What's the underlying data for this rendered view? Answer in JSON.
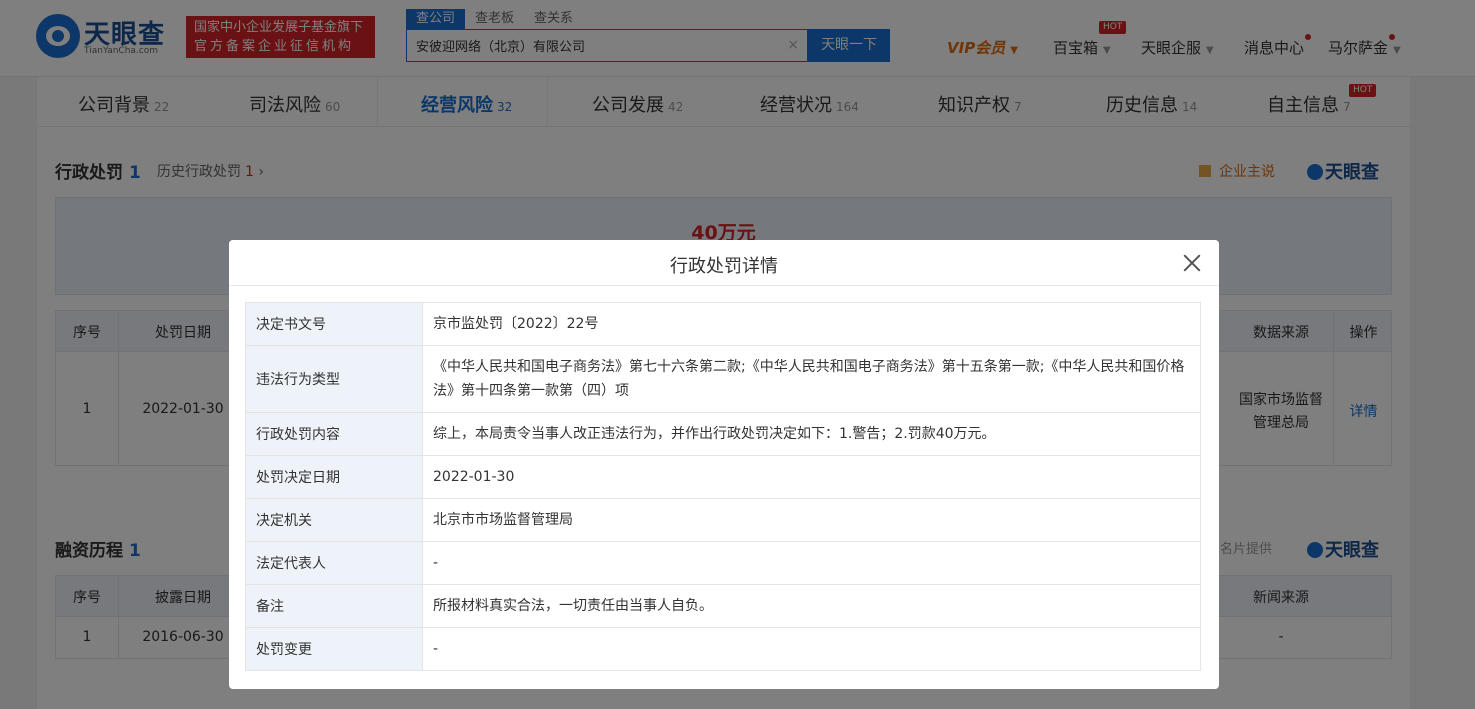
{
  "header": {
    "logo_text": "天眼查",
    "logo_sub": "TianYanCha.com",
    "red_badge_line1": "国家中小企业发展子基金旗下",
    "red_badge_line2": "官方备案企业征信机构",
    "search_tabs": [
      "查公司",
      "查老板",
      "查关系"
    ],
    "search_value": "安彼迎网络（北京）有限公司",
    "search_clear": "×",
    "search_button": "天眼一下",
    "nav": {
      "vip": "VIP会员",
      "baibaoxiang": "百宝箱",
      "hot": "HOT",
      "qifu": "天眼企服",
      "messages": "消息中心",
      "user": "马尔萨金"
    }
  },
  "tabs": [
    {
      "label": "公司背景",
      "count": "22"
    },
    {
      "label": "司法风险",
      "count": "60"
    },
    {
      "label": "经营风险",
      "count": "32"
    },
    {
      "label": "公司发展",
      "count": "42"
    },
    {
      "label": "经营状况",
      "count": "164"
    },
    {
      "label": "知识产权",
      "count": "7"
    },
    {
      "label": "历史信息",
      "count": "14"
    },
    {
      "label": "自主信息",
      "count": "7"
    }
  ],
  "tab_hot": "HOT",
  "penalty_section": {
    "title": "行政处罚",
    "count": "1",
    "history_label": "历史行政处罚",
    "history_count": "1",
    "history_arrow": "›",
    "ent_say": "企业主说",
    "brand": "天眼查",
    "amount": "40万元",
    "table_headers": [
      "序号",
      "处罚日期",
      "数据来源",
      "操作"
    ],
    "row": {
      "index": "1",
      "date": "2022-01-30",
      "source": "国家市场监督管理总局",
      "action": "详情"
    }
  },
  "finance_section": {
    "title": "融资历程",
    "count": "1",
    "provided_by": "企名片提供",
    "brand": "天眼查",
    "table_headers": [
      "序号",
      "披露日期",
      "新闻来源"
    ],
    "row": {
      "index": "1",
      "date": "2016-06-30",
      "news": "-"
    }
  },
  "modal": {
    "title": "行政处罚详情",
    "rows": [
      {
        "label": "决定书文号",
        "value": "京市监处罚〔2022〕22号"
      },
      {
        "label": "违法行为类型",
        "value": "《中华人民共和国电子商务法》第七十六条第二款;《中华人民共和国电子商务法》第十五条第一款;《中华人民共和国价格法》第十四条第一款第（四）项"
      },
      {
        "label": "行政处罚内容",
        "value": "综上，本局责令当事人改正违法行为，并作出行政处罚决定如下：1.警告；2.罚款40万元。"
      },
      {
        "label": "处罚决定日期",
        "value": "2022-01-30"
      },
      {
        "label": "决定机关",
        "value": "北京市市场监督管理局"
      },
      {
        "label": "法定代表人",
        "value": "-"
      },
      {
        "label": "备注",
        "value": "所报材料真实合法，一切责任由当事人自负。"
      },
      {
        "label": "处罚变更",
        "value": "-"
      }
    ]
  },
  "colors": {
    "brand_blue": "#1a6fd1",
    "accent_red": "#d42427",
    "vip_orange": "#e06a0d"
  }
}
